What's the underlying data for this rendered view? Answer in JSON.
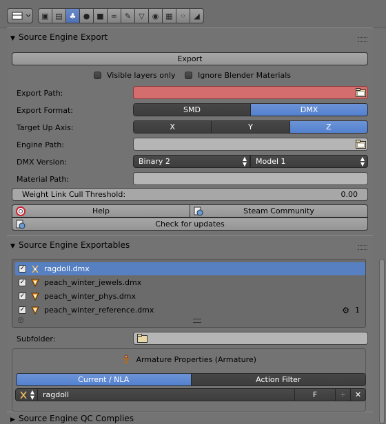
{
  "header": {
    "editor_icon": "properties-editor-icon",
    "tabs": [
      {
        "name": "render-tab",
        "icon": "camera-icon",
        "glyph": "▣"
      },
      {
        "name": "render-layers-tab",
        "icon": "layers-icon",
        "glyph": "▤"
      },
      {
        "name": "scene-tab",
        "icon": "scene-icon",
        "glyph": "♣",
        "active": true
      },
      {
        "name": "world-tab",
        "icon": "world-icon",
        "glyph": "●"
      },
      {
        "name": "object-tab",
        "icon": "cube-icon",
        "glyph": "■"
      },
      {
        "name": "constraints-tab",
        "icon": "constraint-icon",
        "glyph": "∞"
      },
      {
        "name": "modifiers-tab",
        "icon": "wrench-icon",
        "glyph": "✎"
      },
      {
        "name": "data-tab",
        "icon": "mesh-data-icon",
        "glyph": "▽"
      },
      {
        "name": "material-tab",
        "icon": "material-icon",
        "glyph": "◉"
      },
      {
        "name": "texture-tab",
        "icon": "texture-icon",
        "glyph": "▦"
      },
      {
        "name": "particles-tab",
        "icon": "particles-icon",
        "glyph": "⁘"
      },
      {
        "name": "physics-tab",
        "icon": "physics-icon",
        "glyph": "◢"
      }
    ]
  },
  "export_panel": {
    "title": "Source Engine Export",
    "export_button": "Export",
    "visible_layers_only": "Visible layers only",
    "ignore_blender_materials": "Ignore Blender Materials",
    "export_path_label": "Export Path:",
    "export_path_value": "",
    "export_format_label": "Export Format:",
    "format_options": [
      "SMD",
      "DMX"
    ],
    "format_selected": "DMX",
    "target_up_axis_label": "Target Up Axis:",
    "axis_options": [
      "X",
      "Y",
      "Z"
    ],
    "axis_selected": "Z",
    "engine_path_label": "Engine Path:",
    "engine_path_value": "",
    "dmx_version_label": "DMX Version:",
    "dmx_version_value": "Binary 2",
    "dmx_model_value": "Model 1",
    "material_path_label": "Material Path:",
    "material_path_value": "",
    "weight_link_label": "Weight Link Cull Threshold:",
    "weight_link_value": "0.00",
    "help_button": "Help",
    "steam_button": "Steam Community",
    "updates_button": "Check for updates"
  },
  "exportables_panel": {
    "title": "Source Engine Exportables",
    "items": [
      {
        "label": "ragdoll.dmx",
        "icon": "armature-icon",
        "checked": true,
        "selected": true
      },
      {
        "label": "peach_winter_jewels.dmx",
        "icon": "mesh-icon",
        "checked": true,
        "selected": false
      },
      {
        "label": "peach_winter_phys.dmx",
        "icon": "mesh-icon",
        "checked": true,
        "selected": false
      },
      {
        "label": "peach_winter_reference.dmx",
        "icon": "mesh-icon",
        "checked": true,
        "selected": false,
        "shape_keys": "1"
      }
    ],
    "subfolder_label": "Subfolder:",
    "subfolder_value": "",
    "armature_title": "Armature Properties (Armature)",
    "action_tabs": [
      "Current / NLA",
      "Action Filter"
    ],
    "action_tab_selected": "Current / NLA",
    "action_name": "ragdoll",
    "fake_user": "F"
  },
  "collapsed_panel": {
    "title": "Source Engine QC Complies"
  },
  "colors": {
    "accent": "#5680c2",
    "missing_path": "#d46d6d"
  }
}
